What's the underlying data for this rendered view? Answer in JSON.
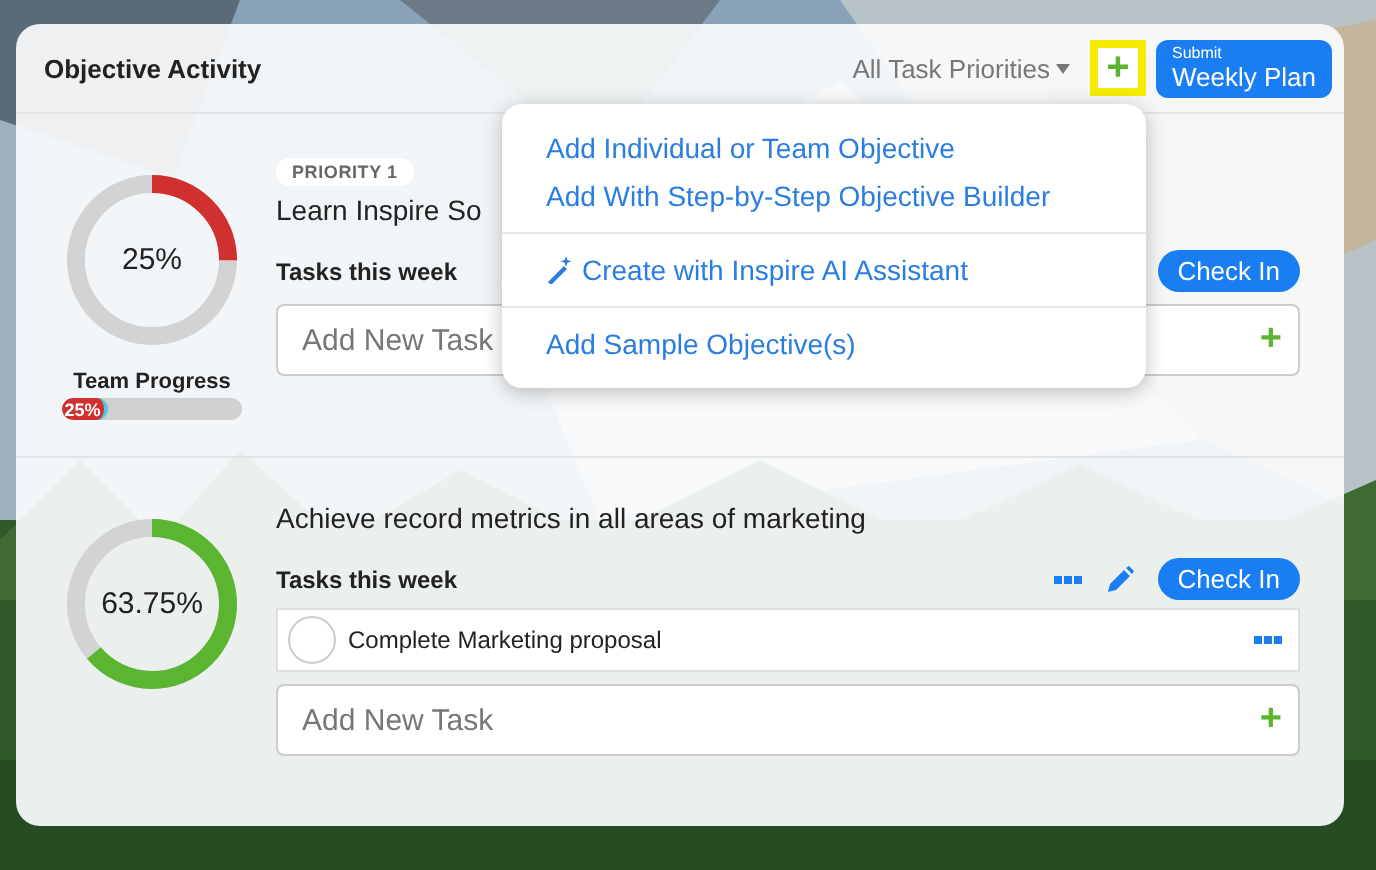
{
  "header": {
    "title": "Objective Activity",
    "filter": "All Task Priorities",
    "add_button": {
      "label": "+",
      "highlighted": true
    },
    "submit_button": {
      "small": "Submit",
      "label": "Weekly Plan"
    }
  },
  "objectives": [
    {
      "priority": "PRIORITY 1",
      "title": "Learn Inspire So",
      "level": 0.25,
      "reading": "25%",
      "color": "#d0302f",
      "team_progress": {
        "label": "Team Progress",
        "level": 0.25,
        "reading": "25%"
      },
      "tasks_label": "Tasks this week",
      "check_in": "Check In",
      "add_placeholder": "Add New Task",
      "add_icon": "+"
    },
    {
      "title": "Achieve record metrics in all areas of marketing",
      "level": 0.6375,
      "reading": "63.75%",
      "color": "#5cb531",
      "tasks_label": "Tasks this week",
      "check_in": "Check In",
      "tasks": [
        {
          "label": "Complete Marketing proposal",
          "checked": false
        }
      ],
      "add_placeholder": "Add New Task",
      "add_icon": "+"
    }
  ],
  "menu": {
    "groups": [
      [
        {
          "label": "Add Individual or Team Objective",
          "kind": "plain"
        },
        {
          "label": "Add With Step-by-Step Objective Builder",
          "kind": "plain"
        }
      ],
      [
        {
          "label": "Create with Inspire AI Assistant",
          "kind": "wand"
        }
      ],
      [
        {
          "label": "Add Sample Objective(s)",
          "kind": "plain"
        }
      ]
    ]
  }
}
